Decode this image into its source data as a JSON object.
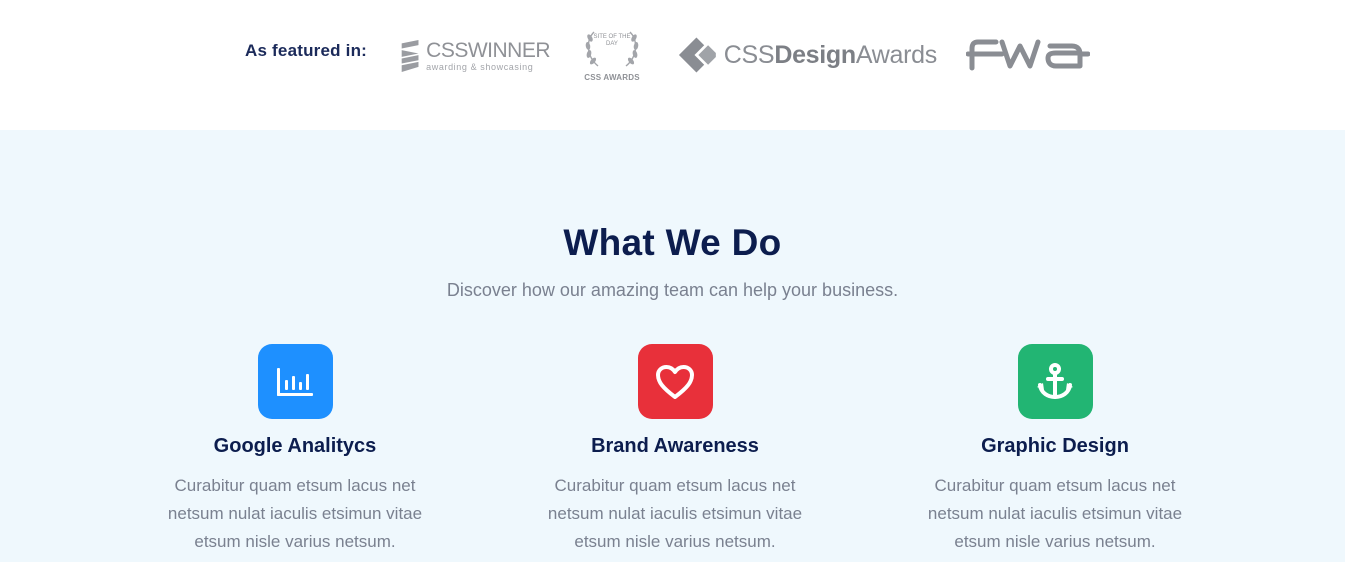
{
  "featured": {
    "label": "As featured in:",
    "logos": {
      "csswinner": {
        "title": "CSSWINNER",
        "subtitle": "awarding & showcasing"
      },
      "sotd": {
        "badge": "SITE OF THE DAY",
        "caption": "CSS AWARDS"
      },
      "cssda": {
        "prefix": "CSS",
        "bold": "Design",
        "suffix": "Awards"
      },
      "fwa": {
        "name": "FWA"
      }
    }
  },
  "services": {
    "title": "What We Do",
    "subtitle": "Discover how our amazing team can help your business.",
    "cards": [
      {
        "title": "Google Analitycs",
        "text": "Curabitur quam etsum lacus net netsum nulat iaculis etsimun vitae etsum nisle varius netsum.",
        "icon": "bar-chart-icon",
        "color": "#1e90ff"
      },
      {
        "title": "Brand Awareness",
        "text": "Curabitur quam etsum lacus net netsum nulat iaculis etsimun vitae etsum nisle varius netsum.",
        "icon": "heart-icon",
        "color": "#e8303a"
      },
      {
        "title": "Graphic Design",
        "text": "Curabitur quam etsum lacus net netsum nulat iaculis etsimun vitae etsum nisle varius netsum.",
        "icon": "anchor-icon",
        "color": "#22b573"
      }
    ]
  }
}
